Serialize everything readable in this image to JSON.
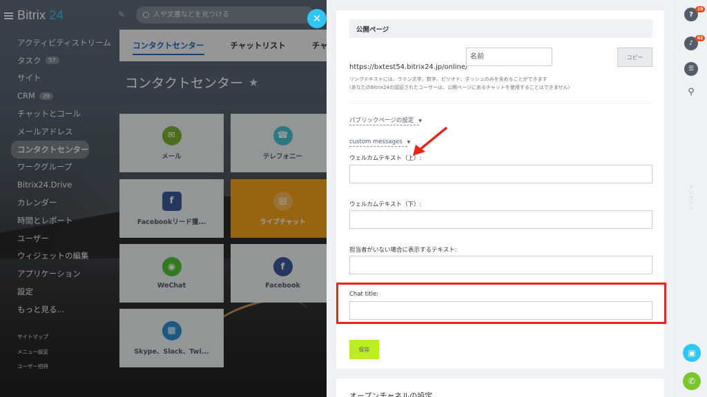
{
  "topbar": {
    "brand_name": "Bitrix",
    "brand_number": "24",
    "search_placeholder": "人や文書などを見つける",
    "close_label": "✕"
  },
  "sidebar": {
    "items": [
      {
        "label": "アクティビティストリーム",
        "badge": ""
      },
      {
        "label": "タスク",
        "badge": "57"
      },
      {
        "label": "サイト",
        "badge": ""
      },
      {
        "label": "CRM",
        "badge": "39"
      },
      {
        "label": "チャットとコール",
        "badge": ""
      },
      {
        "label": "メールアドレス",
        "badge": ""
      },
      {
        "label": "コンタクトセンター",
        "badge": "",
        "active": true
      },
      {
        "label": "ワークグループ",
        "badge": ""
      },
      {
        "label": "Bitrix24.Drive",
        "badge": ""
      },
      {
        "label": "カレンダー",
        "badge": ""
      },
      {
        "label": "時間とレポート",
        "badge": ""
      },
      {
        "label": "ユーザー",
        "badge": ""
      },
      {
        "label": "ウィジェットの編集",
        "badge": ""
      },
      {
        "label": "アプリケーション",
        "badge": ""
      },
      {
        "label": "設定",
        "badge": ""
      },
      {
        "label": "もっと見る...",
        "badge": ""
      }
    ],
    "footer_links": [
      "サイトマップ",
      "メニュー設定",
      "ユーザー招待"
    ]
  },
  "main": {
    "tabs": [
      "コンタクトセンター",
      "チャットリスト",
      "チャッ"
    ],
    "title": "コンタクトセンター",
    "tiles": [
      {
        "label": "メール",
        "icon": "mail-icon",
        "color": "#7ab32e"
      },
      {
        "label": "テレフォニー",
        "icon": "phone-icon",
        "color": "#47c2d2"
      },
      {
        "label": "Facebookリード獲...",
        "icon": "facebook-lead-icon",
        "color": "#3b5998"
      },
      {
        "label": "ライブチャット",
        "icon": "chat-icon",
        "color": "#f4a31c"
      },
      {
        "label": "WeChat",
        "icon": "wechat-icon",
        "color": "#51c332"
      },
      {
        "label": "Facebook",
        "icon": "facebook-icon",
        "color": "#3b5998"
      },
      {
        "label": "Skype、Slack、Twi...",
        "icon": "apps-icon",
        "color": "#2f8fd4"
      }
    ]
  },
  "panel": {
    "section_title": "公開ページ",
    "url_label": "https://bxtest54.bitrix24.jp/online/",
    "name_placeholder": "名前",
    "copy_button": "コピー",
    "hint_line1": "リンクテキストには、ラテン文字、数字、ピリオド、ダッシュのみを含めることができます",
    "hint_line2": "(あなたのBitrix24の認証されたユーザーは、公開ページにあるチャットを使用することはできません)",
    "public_page_settings": "パブリックページの設定",
    "custom_messages": "custom messages",
    "welcome_top_label": "ウェルカムテキスト（上）:",
    "welcome_bottom_label": "ウェルカムテキスト（下）:",
    "no_agent_label": "担当者がいない場合に表示するテキスト:",
    "chat_title_label": "Chat title:",
    "save_button": "保存",
    "open_channel_settings": "オープンチャネルの設定"
  },
  "rail": {
    "help_count": "19",
    "notify_count": "62",
    "vertical_text": "オンライン"
  },
  "colors": {
    "accent": "#2fc6f6",
    "highlight_box": "#e8251d",
    "save_button": "#bbed21",
    "active_tab": "#2067b0"
  }
}
